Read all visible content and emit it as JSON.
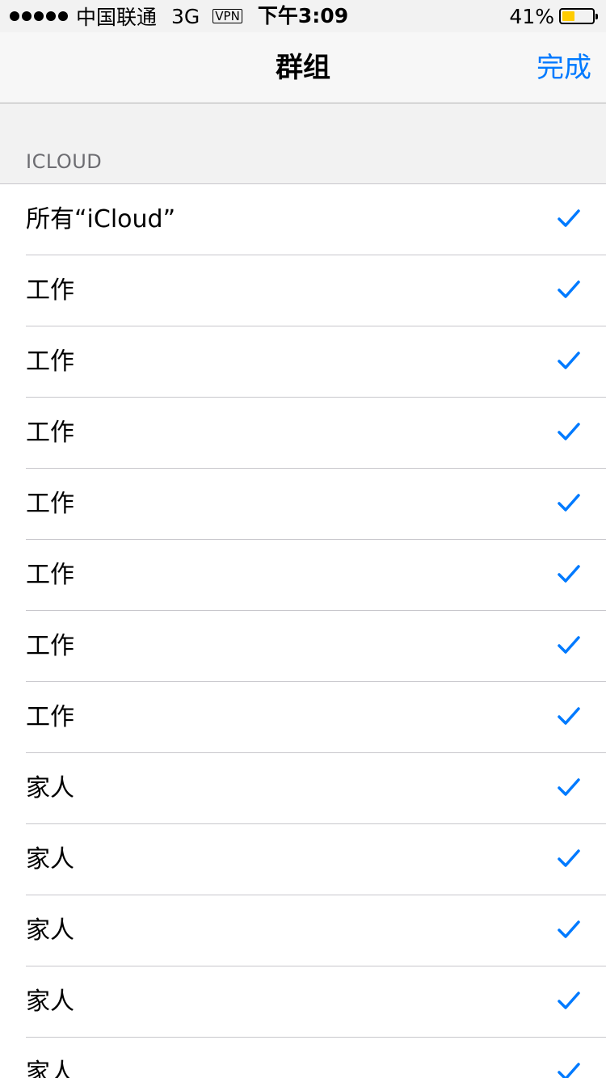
{
  "status_bar": {
    "carrier": "中国联通",
    "network": "3G",
    "vpn": "VPN",
    "time": "下午3:09",
    "battery_percent_label": "41%",
    "battery_level": 0.41,
    "battery_color": "#ffcc00"
  },
  "nav": {
    "title": "群组",
    "done_label": "完成"
  },
  "section": {
    "header": "ICLOUD"
  },
  "groups": [
    {
      "label": "所有“iCloud”",
      "checked": true
    },
    {
      "label": "工作",
      "checked": true
    },
    {
      "label": "工作",
      "checked": true
    },
    {
      "label": "工作",
      "checked": true
    },
    {
      "label": "工作",
      "checked": true
    },
    {
      "label": "工作",
      "checked": true
    },
    {
      "label": "工作",
      "checked": true
    },
    {
      "label": "工作",
      "checked": true
    },
    {
      "label": "家人",
      "checked": true
    },
    {
      "label": "家人",
      "checked": true
    },
    {
      "label": "家人",
      "checked": true
    },
    {
      "label": "家人",
      "checked": true
    },
    {
      "label": "家人",
      "checked": true
    }
  ],
  "colors": {
    "accent": "#007aff"
  }
}
